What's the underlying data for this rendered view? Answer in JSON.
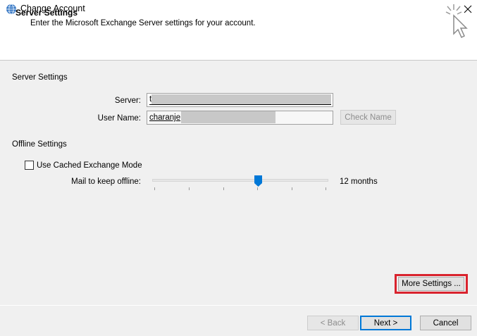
{
  "window": {
    "title": "Change Account"
  },
  "header": {
    "title": "Server Settings",
    "subtitle": "Enter the Microsoft Exchange Server settings for your account."
  },
  "server_settings": {
    "section_label": "Server Settings",
    "server_label": "Server:",
    "server_value": "t",
    "username_label": "User Name:",
    "username_value": "charanje",
    "check_name_label": "Check Name"
  },
  "offline_settings": {
    "section_label": "Offline Settings",
    "cached_mode_label": "Use Cached Exchange Mode",
    "cached_mode_checked": false,
    "mail_offline_label": "Mail to keep offline:",
    "mail_offline_value": "12 months",
    "slider_position_fraction": 0.6
  },
  "more_settings_label": "More Settings ...",
  "footer": {
    "back_label": "< Back",
    "next_label": "Next >",
    "cancel_label": "Cancel"
  },
  "colors": {
    "accent": "#0078d7",
    "highlight": "#d9232e",
    "background": "#f0f0f0"
  },
  "icons": {
    "app": "outlook-globe-icon",
    "close": "close-icon",
    "header": "click-cursor-icon"
  }
}
